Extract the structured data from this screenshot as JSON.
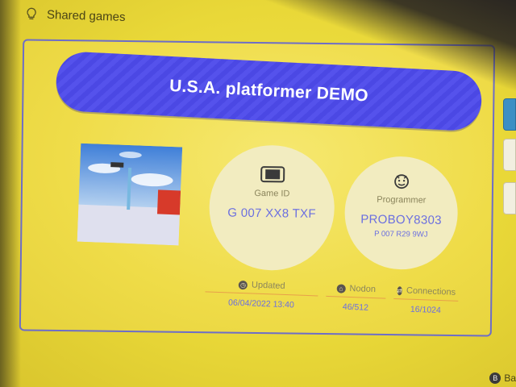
{
  "header": {
    "title": "Shared games",
    "icon": "lightbulb-icon"
  },
  "game": {
    "title": "U.S.A. platformer DEMO",
    "game_id_label": "Game ID",
    "game_id": "G 007 XX8 TXF",
    "programmer_label": "Programmer",
    "programmer_name": "PROBOY8303",
    "programmer_id": "P 007 R29 9WJ"
  },
  "stats": {
    "updated_label": "Updated",
    "updated_value": "06/04/2022 13:40",
    "nodes_label": "Nodon",
    "nodes_value": "46/512",
    "connections_label": "Connections",
    "connections_value": "16/1024"
  },
  "footer": {
    "back_label": "Ba",
    "back_button": "B"
  },
  "colors": {
    "accent": "#4b48e4",
    "background": "#ecdc40",
    "value_text": "#6b6fe0",
    "selected_side_button": "#3c8fc4"
  }
}
